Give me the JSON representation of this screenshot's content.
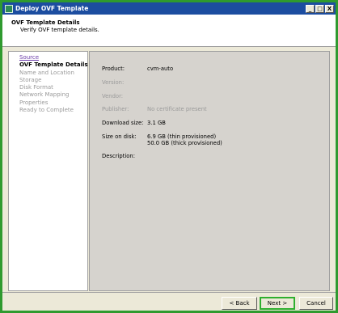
{
  "window": {
    "title": "Deploy OVF Template",
    "minimize_glyph": "_",
    "maximize_glyph": "□",
    "close_glyph": "X"
  },
  "header": {
    "title": "OVF Template Details",
    "subtitle": "Verify OVF template details."
  },
  "nav": {
    "items": [
      {
        "label": "Source",
        "state": "link"
      },
      {
        "label": "OVF Template Details",
        "state": "current"
      },
      {
        "label": "Name and Location",
        "state": "disabled"
      },
      {
        "label": "Storage",
        "state": "disabled"
      },
      {
        "label": "Disk Format",
        "state": "disabled"
      },
      {
        "label": "Network Mapping",
        "state": "disabled"
      },
      {
        "label": "Properties",
        "state": "disabled"
      },
      {
        "label": "Ready to Complete",
        "state": "disabled"
      }
    ]
  },
  "details": {
    "product_label": "Product:",
    "product_value": "cvm-auto",
    "version_label": "Version:",
    "version_value": "",
    "vendor_label": "Vendor:",
    "vendor_value": "",
    "publisher_label": "Publisher:",
    "publisher_value": "No certificate present",
    "download_label": "Download size:",
    "download_value": "3.1 GB",
    "disk_label": "Size on disk:",
    "disk_thin": "6.9 GB (thin provisioned)",
    "disk_thick": "50.0 GB (thick provisioned)",
    "description_label": "Description:",
    "description_value": ""
  },
  "buttons": {
    "back": "< Back",
    "next": "Next >",
    "cancel": "Cancel"
  }
}
